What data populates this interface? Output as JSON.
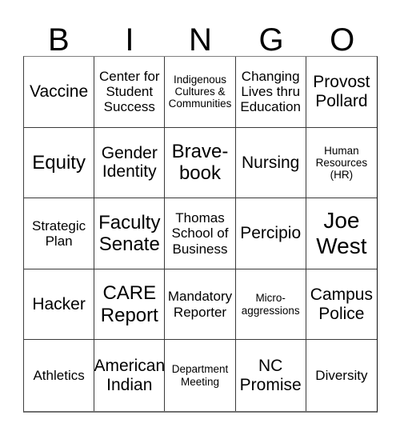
{
  "card": {
    "title": "BINGO Card",
    "background_color": "#ffffff",
    "text_color": "#000000",
    "grid_line_color": "#3a3a3a"
  },
  "header": {
    "letters": [
      "B",
      "I",
      "N",
      "G",
      "O"
    ]
  },
  "grid": {
    "columns": 5,
    "rows": 5,
    "cells": [
      {
        "text": "Vaccine",
        "size": "md"
      },
      {
        "text": "Center for\nStudent\nSuccess",
        "size": "sm"
      },
      {
        "text": "Indigenous\nCultures &\nCommunities",
        "size": "xs"
      },
      {
        "text": "Changing\nLives thru\nEducation",
        "size": "sm"
      },
      {
        "text": "Provost\nPollard",
        "size": "md"
      },
      {
        "text": "Equity",
        "size": "lg"
      },
      {
        "text": "Gender\nIdentity",
        "size": "md"
      },
      {
        "text": "Brave-\nbook",
        "size": "lg"
      },
      {
        "text": "Nursing",
        "size": "md"
      },
      {
        "text": "Human\nResources\n(HR)",
        "size": "xs"
      },
      {
        "text": "Strategic\nPlan",
        "size": "sm"
      },
      {
        "text": "Faculty\nSenate",
        "size": "lg"
      },
      {
        "text": "Thomas\nSchool of\nBusiness",
        "size": "sm"
      },
      {
        "text": "Percipio",
        "size": "md"
      },
      {
        "text": "Joe\nWest",
        "size": "xl"
      },
      {
        "text": "Hacker",
        "size": "md"
      },
      {
        "text": "CARE\nReport",
        "size": "lg"
      },
      {
        "text": "Mandatory\nReporter",
        "size": "sm"
      },
      {
        "text": "Micro-\naggressions",
        "size": "xs"
      },
      {
        "text": "Campus\nPolice",
        "size": "md"
      },
      {
        "text": "Athletics",
        "size": "sm"
      },
      {
        "text": "American\nIndian",
        "size": "md"
      },
      {
        "text": "Department\nMeeting",
        "size": "xs"
      },
      {
        "text": "NC\nPromise",
        "size": "md"
      },
      {
        "text": "Diversity",
        "size": "sm"
      }
    ]
  }
}
